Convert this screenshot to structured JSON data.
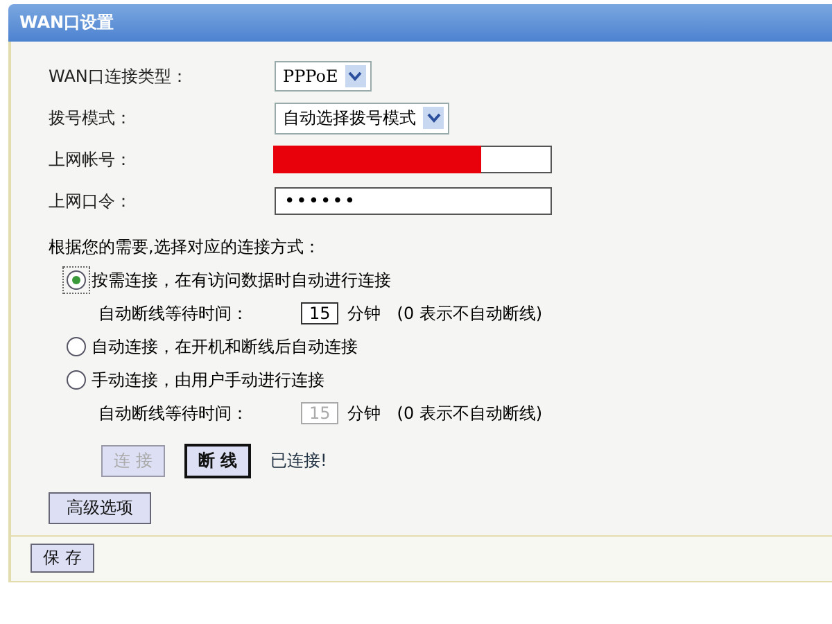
{
  "window": {
    "title": "WAN口设置"
  },
  "fields": [
    {
      "kind": "select",
      "label": "WAN口连接类型：",
      "value": "PPPoE"
    },
    {
      "kind": "select",
      "label": "拨号模式：",
      "value": "自动选择拨号模式"
    },
    {
      "kind": "redacted",
      "label": "上网帐号："
    },
    {
      "kind": "password",
      "label": "上网口令：",
      "value": "••••••"
    }
  ],
  "connection_prompt": "根据您的需要,选择对应的连接方式：",
  "modes": [
    {
      "label": "按需连接，在有访问数据时自动进行连接",
      "selected": true,
      "timeout": {
        "label": "自动断线等待时间：",
        "value": "15",
        "unit": "分钟",
        "note": "(0 表示不自动断线)",
        "disabled": false
      }
    },
    {
      "label": "自动连接，在开机和断线后自动连接",
      "selected": false
    },
    {
      "label": "手动连接，由用户手动进行连接",
      "selected": false,
      "timeout": {
        "label": "自动断线等待时间：",
        "value": "15",
        "unit": "分钟",
        "note": "(0 表示不自动断线)",
        "disabled": true
      }
    }
  ],
  "actions": [
    {
      "label": "连 接",
      "disabled": true
    },
    {
      "label": "断 线",
      "disabled": false
    }
  ],
  "status": "已连接!",
  "advanced_button": "高级选项",
  "save_button": "保 存"
}
